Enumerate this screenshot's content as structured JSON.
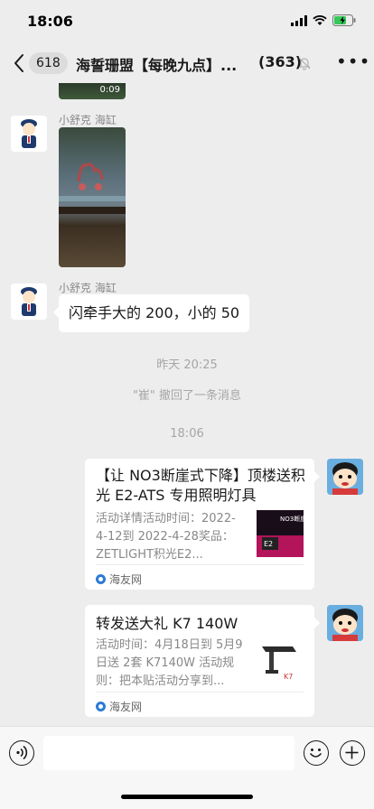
{
  "status": {
    "time": "18:06"
  },
  "nav": {
    "unread_count": "618",
    "title": "海誓珊盟【每晚九点】...",
    "member_count": "(363)"
  },
  "messages": {
    "top_video_duration": "0:09",
    "sender_1": "小舒克 海缸",
    "sender_2": "小舒克 海缸",
    "text_1": "闪牵手大的 200，小的 50",
    "time_yesterday": "昨天 20:25",
    "recall_notice": "\"崔\" 撤回了一条消息",
    "time_today": "18:06"
  },
  "cards": [
    {
      "title": "【让 NO3断崖式下降】顶楼送积光 E2-ATS 专用照明灯具",
      "desc": "活动详情活动时间：2022-4-12到 2022-4-28奖品： ZETLIGHT积光E2...",
      "source": "海友网",
      "thumb_text": "NO3断崖",
      "thumb_brand": "E2"
    },
    {
      "title": "转发送大礼 K7 140W",
      "desc": "活动时间：4月18日到 5月9日送 2套 K7140W 活动规则：把本贴活动分享到...",
      "source": "海友网",
      "thumb_text": "K7"
    }
  ],
  "input": {
    "placeholder": ""
  }
}
